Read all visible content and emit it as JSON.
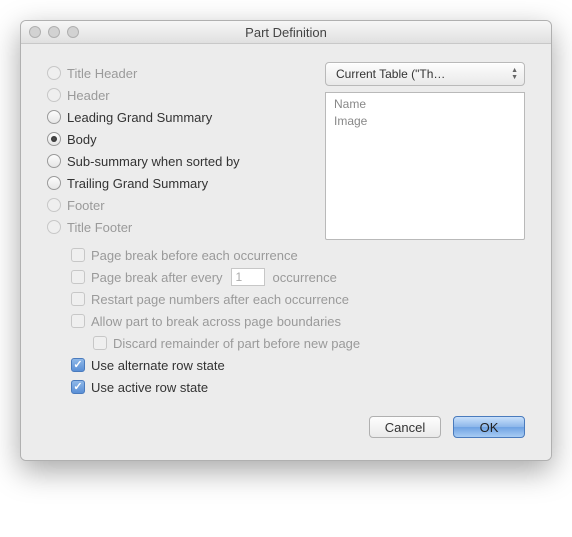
{
  "window": {
    "title": "Part Definition"
  },
  "radios": {
    "title_header": "Title Header",
    "header": "Header",
    "leading_grand_summary": "Leading Grand Summary",
    "body": "Body",
    "sub_summary": "Sub-summary when sorted by",
    "trailing_grand_summary": "Trailing Grand Summary",
    "footer": "Footer",
    "title_footer": "Title Footer"
  },
  "table_popup": {
    "label": "Current Table (\"Th…"
  },
  "field_list": {
    "items": [
      "Name",
      "Image"
    ]
  },
  "options": {
    "page_break_before": "Page break before each occurrence",
    "page_break_after_pre": "Page break after every",
    "page_break_after_value": "1",
    "page_break_after_post": "occurrence",
    "restart_page_numbers": "Restart page numbers after each occurrence",
    "allow_break": "Allow part to break across page boundaries",
    "discard_remainder": "Discard remainder of part before new page",
    "use_alternate_row": "Use alternate row state",
    "use_active_row": "Use active row state"
  },
  "buttons": {
    "cancel": "Cancel",
    "ok": "OK"
  }
}
